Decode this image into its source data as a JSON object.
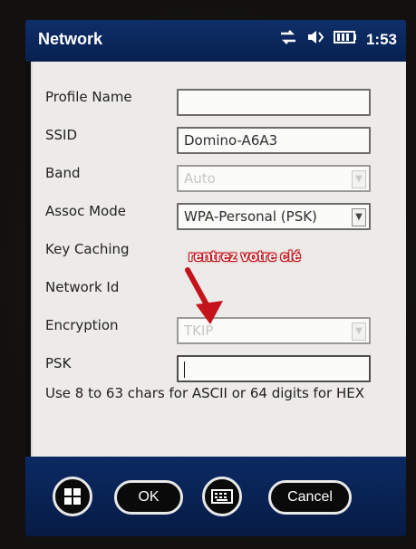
{
  "titlebar": {
    "title": "Network",
    "clock": "1:53"
  },
  "form": {
    "profile_name": {
      "label": "Profile Name",
      "value": ""
    },
    "ssid": {
      "label": "SSID",
      "value": "Domino-A6A3"
    },
    "band": {
      "label": "Band",
      "value": "Auto"
    },
    "assoc_mode": {
      "label": "Assoc Mode",
      "value": "WPA-Personal (PSK)"
    },
    "key_caching": {
      "label": "Key Caching"
    },
    "network_id": {
      "label": "Network Id"
    },
    "encryption": {
      "label": "Encryption",
      "value": "TKIP"
    },
    "psk": {
      "label": "PSK",
      "value": ""
    },
    "help": "Use 8 to 63 chars for ASCII or 64 digits for HEX"
  },
  "annotation": {
    "text": "rentrez votre clé"
  },
  "bottom": {
    "ok": "OK",
    "cancel": "Cancel"
  },
  "icons": [
    "windows-icon",
    "keyboard-icon",
    "connectivity-icon",
    "volume-icon",
    "battery-icon"
  ]
}
